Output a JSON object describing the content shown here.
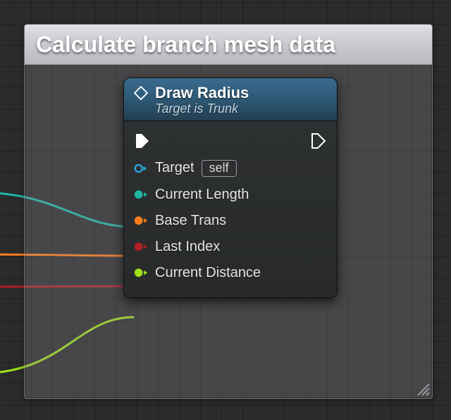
{
  "comment": {
    "title": "Calculate branch mesh data"
  },
  "node": {
    "title": "Draw Radius",
    "subtitle": "Target is Trunk",
    "pins": {
      "target_label": "Target",
      "target_default": "self",
      "current_length_label": "Current Length",
      "base_trans_label": "Base Trans",
      "last_index_label": "Last Index",
      "current_distance_label": "Current Distance"
    }
  },
  "colors": {
    "exec": "#ffffff",
    "object": "#2aa2d6",
    "float_teal": "#1fb8a5",
    "transform_orange": "#ff7d1c",
    "int_red": "#d8262b",
    "wildcard_green": "#9fe21a"
  }
}
